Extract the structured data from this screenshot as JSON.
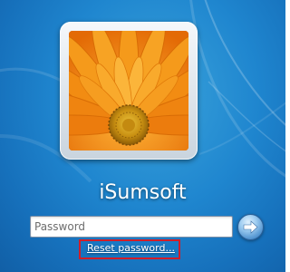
{
  "login": {
    "username": "iSumsoft",
    "password": {
      "placeholder": "Password",
      "value": ""
    },
    "reset_link": "Reset password..."
  },
  "icons": {
    "submit": "arrow-right-icon",
    "avatar": "orange-gerbera-flower"
  },
  "colors": {
    "background": "#1f86cf",
    "highlight_box": "#d11d28",
    "flower_petal": "#f08a12",
    "flower_center": "#d6a21a"
  }
}
